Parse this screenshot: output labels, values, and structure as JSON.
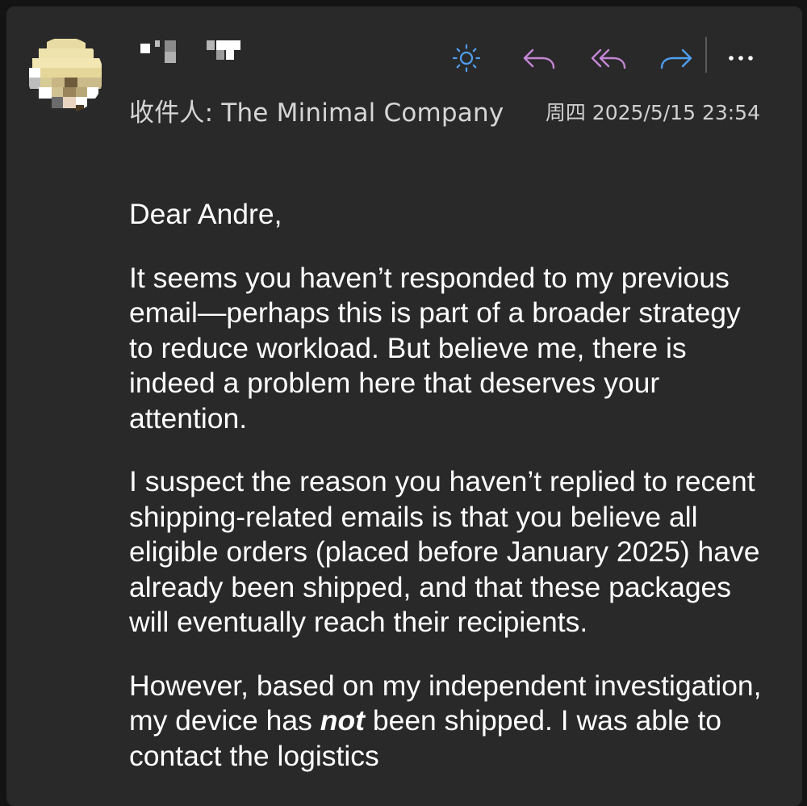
{
  "header": {
    "recipient_label": "收件人:",
    "recipient_name": "The Minimal Company",
    "datetime": "周四 2025/5/15 23:54"
  },
  "toolbar": {
    "items": [
      {
        "name": "brightness-icon",
        "color": "#4f9ff0"
      },
      {
        "name": "reply-icon",
        "color": "#c586d6"
      },
      {
        "name": "reply-all-icon",
        "color": "#c586d6"
      },
      {
        "name": "forward-icon",
        "color": "#4f9ff0"
      },
      {
        "name": "more-icon",
        "color": "#ffffff"
      }
    ]
  },
  "email": {
    "greeting": "Dear Andre,",
    "p1": "It seems you haven’t responded to my previous email—perhaps this is part of a broader strategy to reduce workload. But believe me, there is indeed a problem here that deserves your attention.",
    "p2": "I suspect the reason you haven’t replied to recent shipping-related emails is that you believe all eligible orders (placed before January 2025) have already been shipped, and that these packages will eventually reach their recipients.",
    "p3_before": "However, based on my independent investigation, my device has ",
    "p3_emph": "not",
    "p3_after": " been shipped. I was able to contact the logistics"
  }
}
